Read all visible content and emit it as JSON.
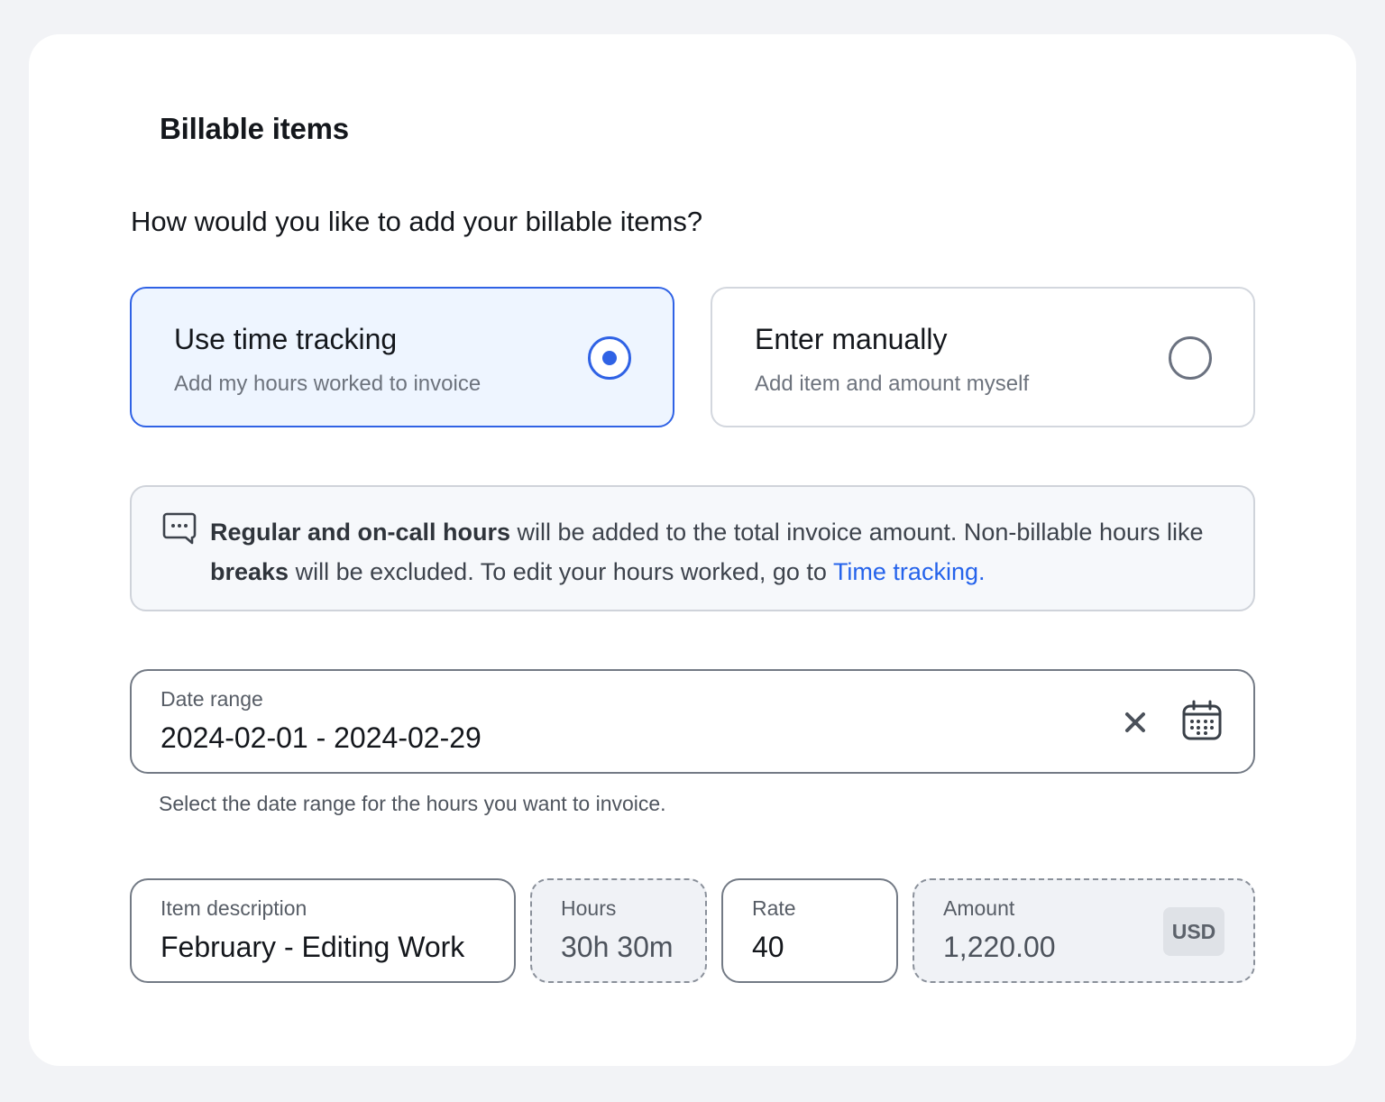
{
  "section": {
    "title": "Billable items"
  },
  "question": "How would you like to add your billable items?",
  "options": [
    {
      "title": "Use time tracking",
      "subtitle": "Add my hours worked to invoice",
      "selected": true
    },
    {
      "title": "Enter manually",
      "subtitle": "Add item and amount myself",
      "selected": false
    }
  ],
  "info": {
    "icon": "message-dots-icon",
    "bold1": "Regular and on-call hours",
    "text1": " will be added to the total invoice amount. Non-billable hours like ",
    "bold2": "breaks",
    "text2": " will be excluded. To edit your hours worked, go to ",
    "link": "Time tracking."
  },
  "date_range": {
    "label": "Date range",
    "value": "2024-02-01 - 2024-02-29",
    "hint": "Select the date range for the hours you want to invoice.",
    "clear_icon": "close-icon",
    "calendar_icon": "calendar-icon"
  },
  "item": {
    "description_label": "Item description",
    "description_value": "February - Editing Work",
    "hours_label": "Hours",
    "hours_value": "30h 30m",
    "rate_label": "Rate",
    "rate_value": "40",
    "amount_label": "Amount",
    "amount_value": "1,220.00",
    "currency": "USD"
  },
  "colors": {
    "accent": "#2f62e5",
    "link": "#2563eb",
    "selected_bg": "#eef5ff",
    "page_bg": "#f2f3f6"
  }
}
